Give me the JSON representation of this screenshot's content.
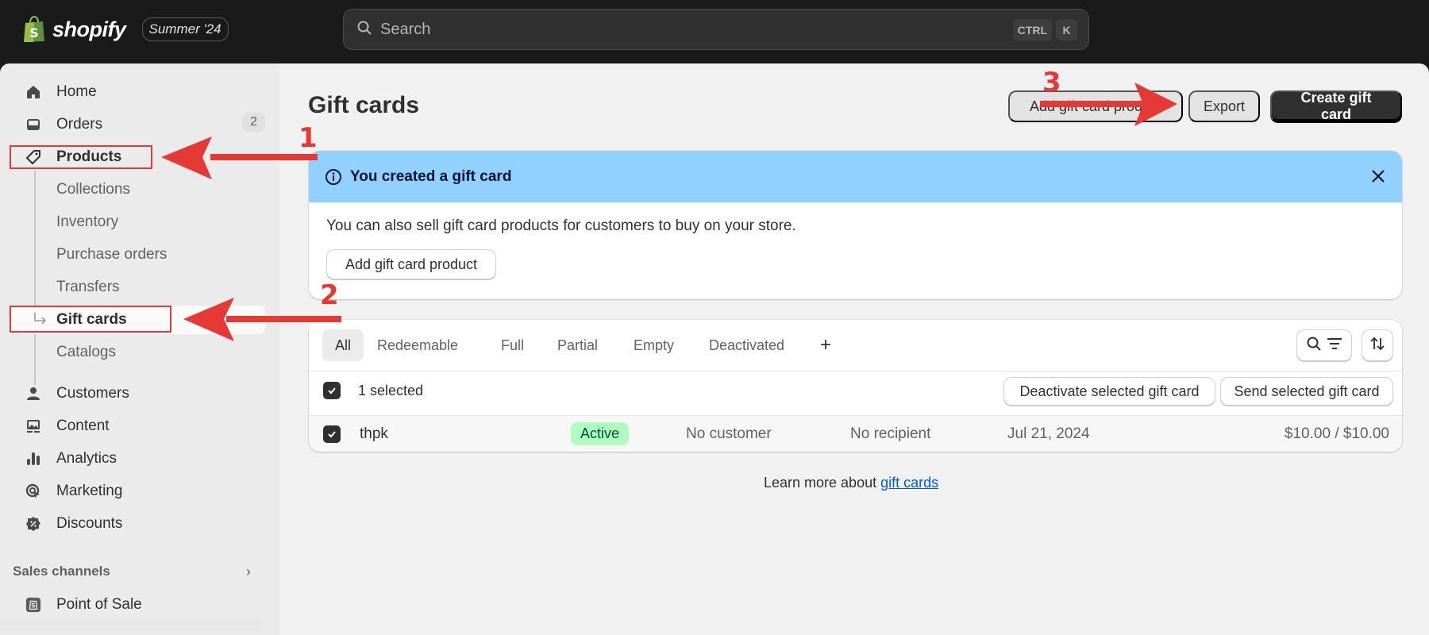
{
  "topbar": {
    "brand": "shopify",
    "edition_badge": "Summer '24",
    "search_placeholder": "Search",
    "shortcut_keys": [
      "CTRL",
      "K"
    ]
  },
  "sidebar": {
    "items": [
      {
        "label": "Home",
        "icon": "home-icon"
      },
      {
        "label": "Orders",
        "icon": "inbox-icon",
        "badge": "2"
      },
      {
        "label": "Products",
        "icon": "tag-icon"
      },
      {
        "label": "Collections"
      },
      {
        "label": "Inventory"
      },
      {
        "label": "Purchase orders"
      },
      {
        "label": "Transfers"
      },
      {
        "label": "Gift cards",
        "active": true
      },
      {
        "label": "Catalogs"
      },
      {
        "label": "Customers",
        "icon": "person-icon"
      },
      {
        "label": "Content",
        "icon": "content-icon"
      },
      {
        "label": "Analytics",
        "icon": "bar-chart-icon"
      },
      {
        "label": "Marketing",
        "icon": "target-icon"
      },
      {
        "label": "Discounts",
        "icon": "discount-icon"
      }
    ],
    "sales_channels_title": "Sales channels",
    "sales_channels": [
      {
        "label": "Point of Sale",
        "icon": "pos-icon"
      }
    ]
  },
  "page": {
    "title": "Gift cards",
    "actions": {
      "add_product": "Add gift card product",
      "export": "Export",
      "create": "Create gift card"
    }
  },
  "banner": {
    "title": "You created a gift card",
    "text": "You can also sell gift card products for customers to buy on your store.",
    "button": "Add gift card product"
  },
  "table": {
    "tabs": [
      "All",
      "Redeemable",
      "Full",
      "Partial",
      "Empty",
      "Deactivated"
    ],
    "selected_tab": "All",
    "add_view_label": "+",
    "selection_label": "1 selected",
    "bulk_actions": [
      "Deactivate selected gift card",
      "Send selected gift card"
    ],
    "rows": [
      {
        "code": "thpk",
        "status": "Active",
        "customer": "No customer",
        "recipient": "No recipient",
        "date": "Jul 21, 2024",
        "balance": "$10.00 / $10.00",
        "checked": true
      }
    ]
  },
  "footer": {
    "learn_more_prefix": "Learn more about ",
    "learn_more_link": "gift cards"
  },
  "annotations": {
    "labels": [
      "1",
      "2",
      "3"
    ],
    "color": "#e53935"
  },
  "colors": {
    "banner_bg": "#91d0ff",
    "status_active_bg": "#affebf",
    "primary_button": "#303030",
    "link": "#005bd3"
  }
}
